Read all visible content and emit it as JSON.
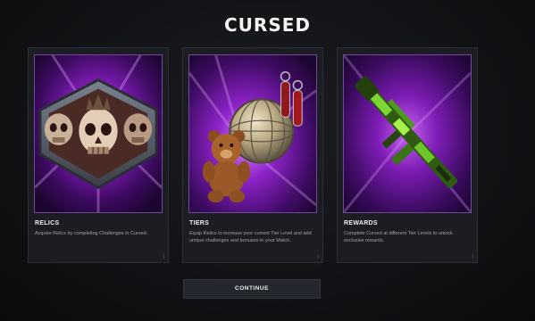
{
  "screen": {
    "title": "CURSED"
  },
  "cards": [
    {
      "heading": "RELICS",
      "description": "Acquire Relics by completing Challenges in Cursed.",
      "art": "skull-relic"
    },
    {
      "heading": "TIERS",
      "description": "Equip Relics to increase your current Tier Level and add unique challenges and bonuses to your Match.",
      "art": "teddy-bear-orb"
    },
    {
      "heading": "REWARDS",
      "description": "Complete Cursed at different Tier Levels to unlock exclusive rewards.",
      "art": "green-rifle"
    }
  ],
  "actions": {
    "continue_label": "CONTINUE"
  },
  "colors": {
    "accent_purple": "#a43ad6",
    "card_bg": "#1b1d22",
    "button_bg": "#24272d",
    "description_text": "#9ea3ab"
  }
}
